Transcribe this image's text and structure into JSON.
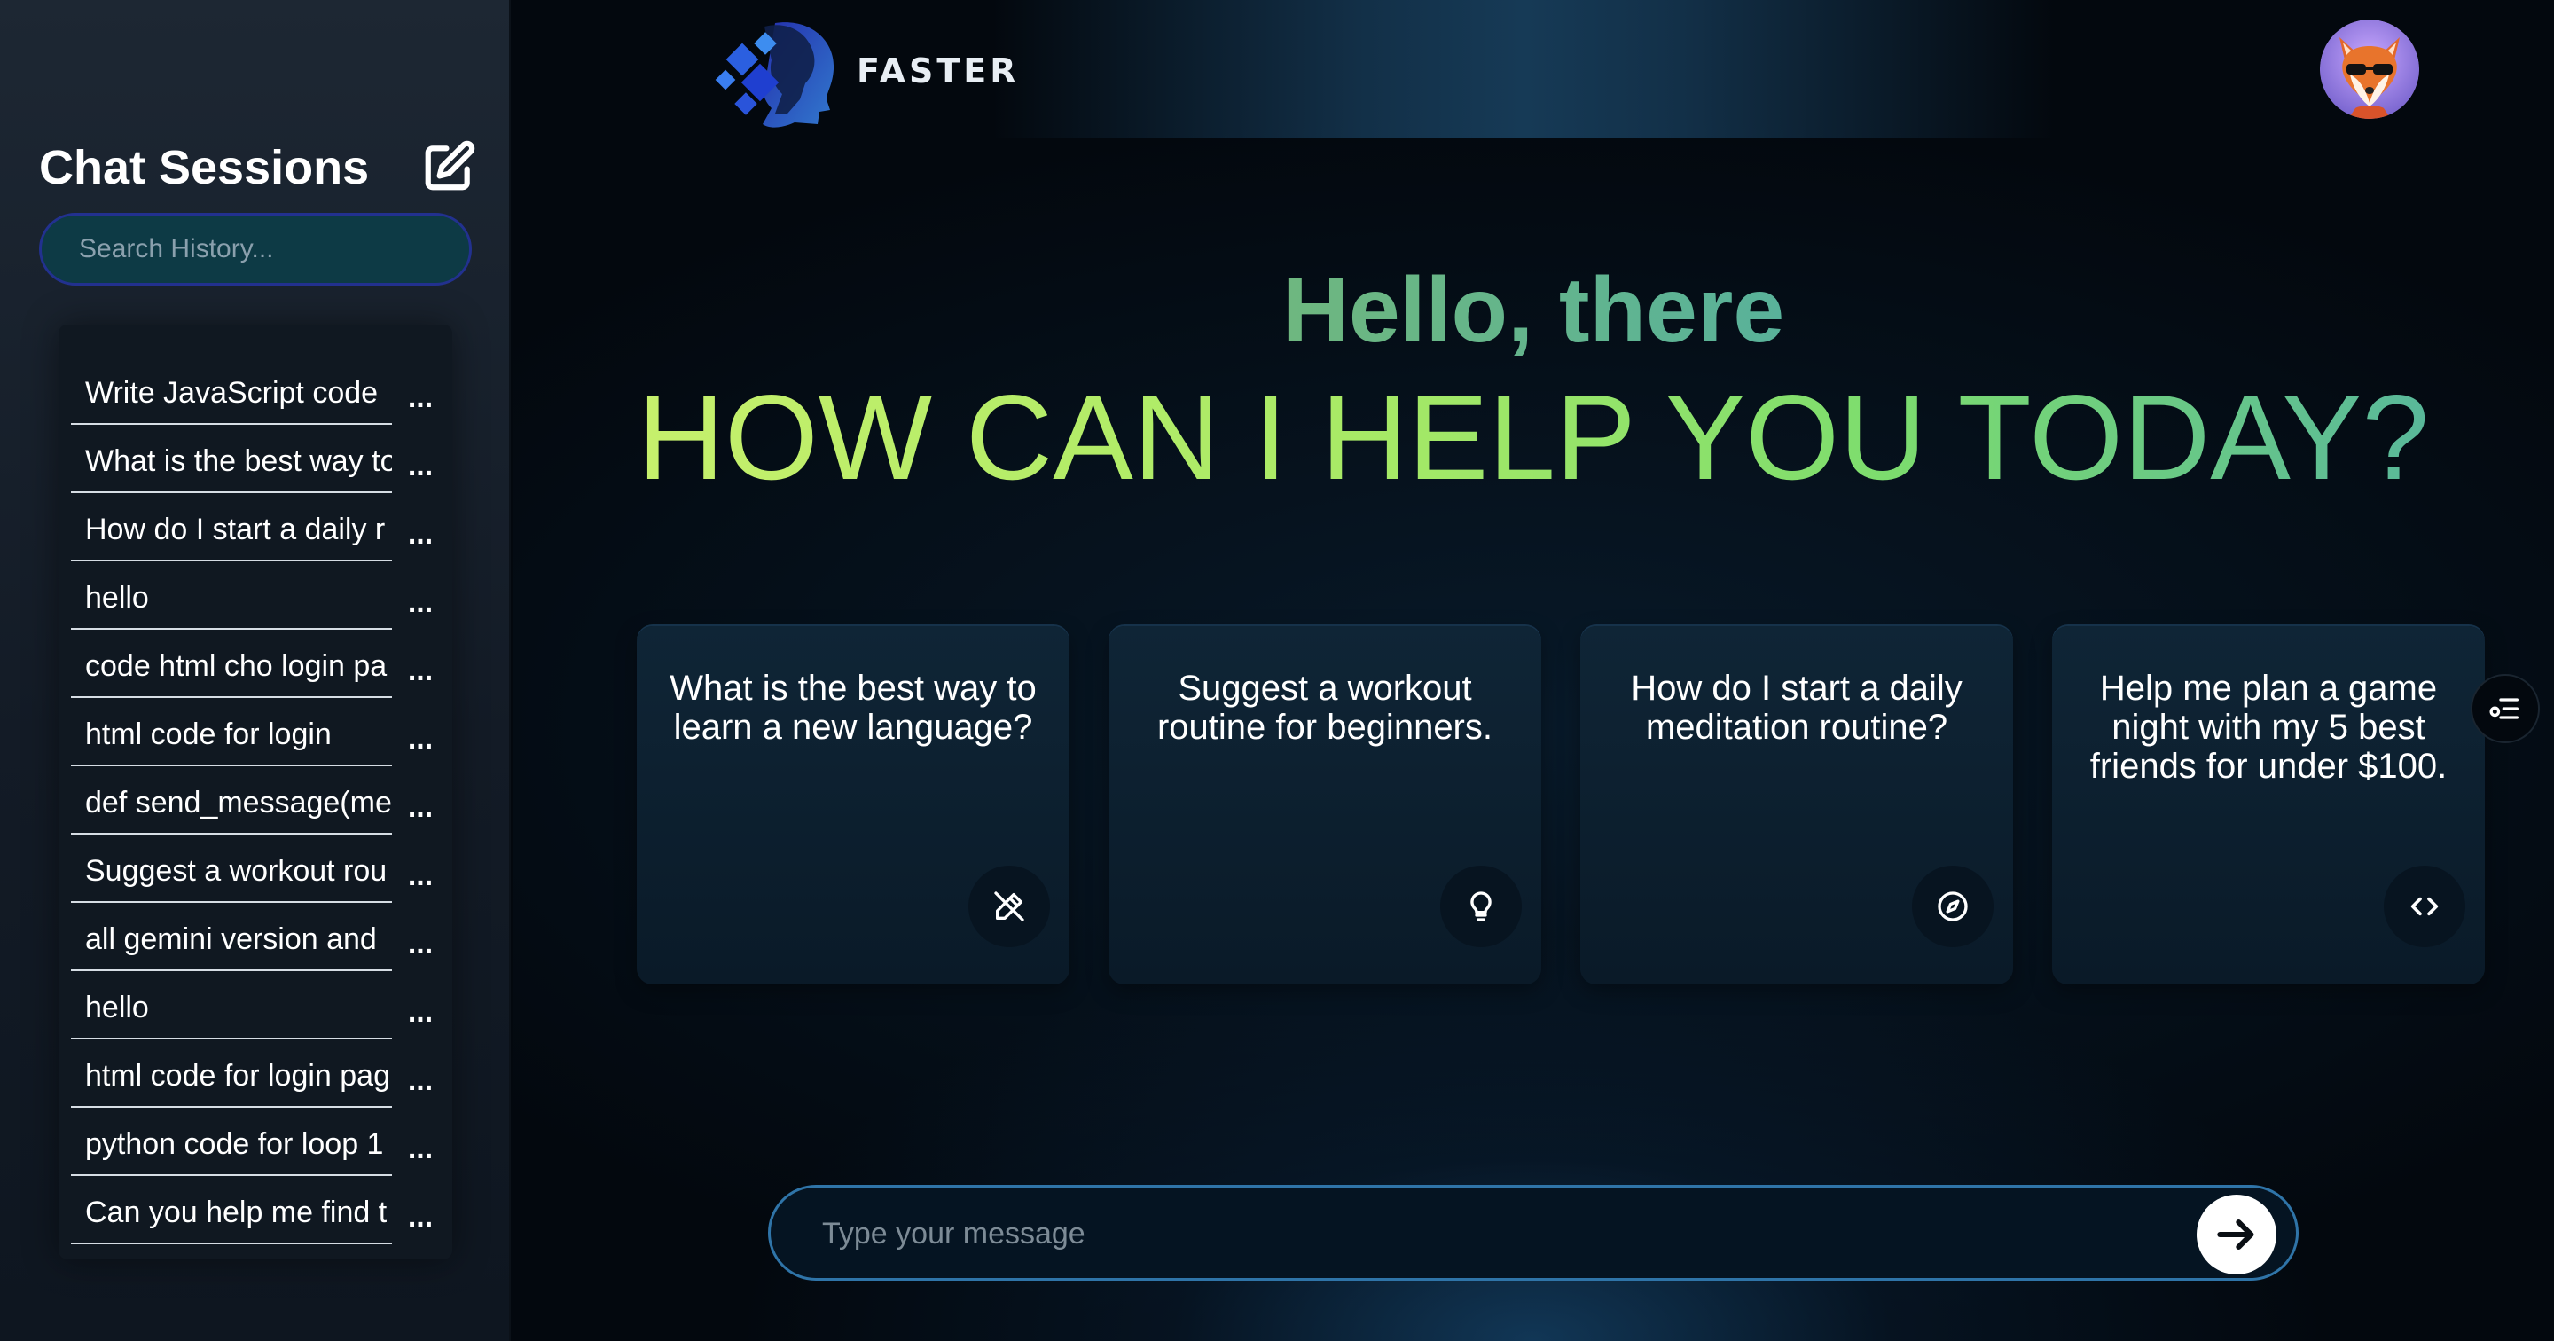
{
  "sidebar": {
    "title": "Chat Sessions",
    "new_chat_icon": "edit-icon",
    "search_placeholder": "Search History...",
    "history": [
      {
        "label": "Write JavaScript code",
        "menu": "..."
      },
      {
        "label": "What is the best way to",
        "menu": "..."
      },
      {
        "label": "How do I start a daily r",
        "menu": "..."
      },
      {
        "label": "hello",
        "menu": "..."
      },
      {
        "label": "code html cho login pa",
        "menu": "..."
      },
      {
        "label": "html code for login",
        "menu": "..."
      },
      {
        "label": "def send_message(me",
        "menu": "..."
      },
      {
        "label": "Suggest a workout rou",
        "menu": "..."
      },
      {
        "label": "all gemini version and",
        "menu": "..."
      },
      {
        "label": "hello",
        "menu": "..."
      },
      {
        "label": "html code for login pag",
        "menu": "..."
      },
      {
        "label": "python code for loop 1",
        "menu": "..."
      },
      {
        "label": "Can you help me find t",
        "menu": "..."
      }
    ]
  },
  "header": {
    "brand_name": "FASTER",
    "logo_icon": "brain-head-logo",
    "avatar_icon": "fox-avatar"
  },
  "main": {
    "greeting": "Hello, there",
    "headline": "HOW CAN I HELP YOU TODAY?",
    "cards": [
      {
        "text": "What is the best way to learn a new language?",
        "icon": "pen-icon"
      },
      {
        "text": "Suggest a workout routine for beginners.",
        "icon": "lightbulb-icon"
      },
      {
        "text": "How do I start a daily meditation routine?",
        "icon": "compass-icon"
      },
      {
        "text": "Help me plan a game night with my 5 best friends for under $100.",
        "icon": "code-icon"
      }
    ],
    "side_toggle_icon": "menu-toggle-icon"
  },
  "composer": {
    "placeholder": "Type your message",
    "value": "",
    "send_icon": "arrow-right-icon"
  },
  "colors": {
    "sidebar_bg": "#1d2733",
    "main_bg": "#03080e",
    "greeting": "#6eb77f",
    "headline_start": "#c6f06c",
    "headline_end": "#59b89a",
    "search_border": "#22318f",
    "composer_border": "#2f74a8"
  }
}
